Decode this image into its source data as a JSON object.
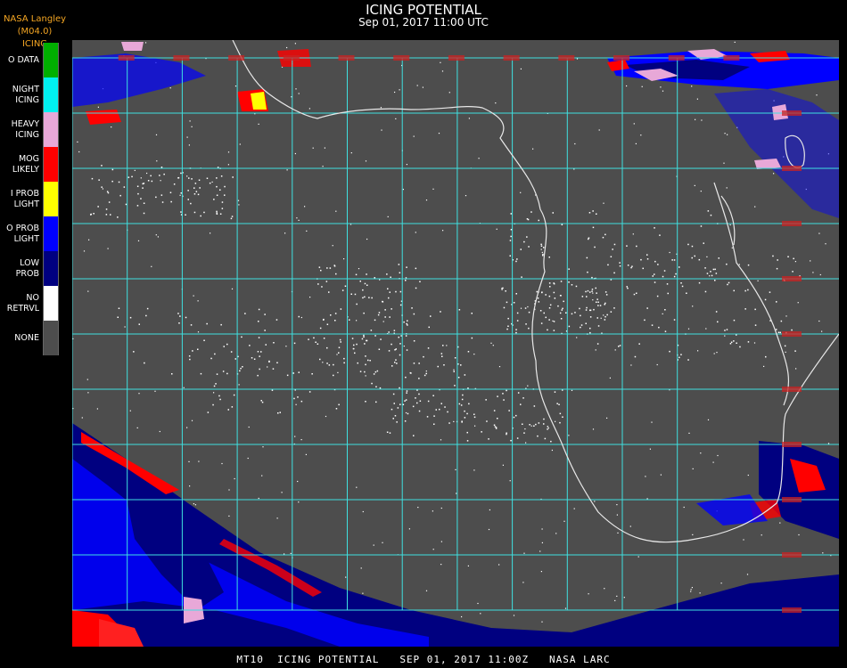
{
  "header": {
    "source": "NASA Langley (M04.0)",
    "product": "ICING",
    "title": "ICING POTENTIAL",
    "datetime": "Sep 01, 2017 11:00 UTC"
  },
  "legend": [
    {
      "label": "O DATA",
      "color": "#00b000"
    },
    {
      "label": "NIGHT\nICING",
      "color": "#00f0f0"
    },
    {
      "label": "HEAVY\nICING",
      "color": "#e8a8d8"
    },
    {
      "label": "MOG\nLIKELY",
      "color": "#ff0000"
    },
    {
      "label": "I PROB\nLIGHT",
      "color": "#ffff00"
    },
    {
      "label": "O PROB\nLIGHT",
      "color": "#0000ff"
    },
    {
      "label": "LOW\nPROB",
      "color": "#000080"
    },
    {
      "label": "NO\nRETRVL",
      "color": "#ffffff"
    },
    {
      "label": "NONE",
      "color": "#4d4d4d"
    }
  ],
  "footer": "MT10  ICING POTENTIAL   SEP 01, 2017 11:00Z   NASA LARC",
  "colors": {
    "grid": "#3fe0e0",
    "coast": "#e8e8e8",
    "label": "#cc2222",
    "background": "#4d4d4d"
  }
}
